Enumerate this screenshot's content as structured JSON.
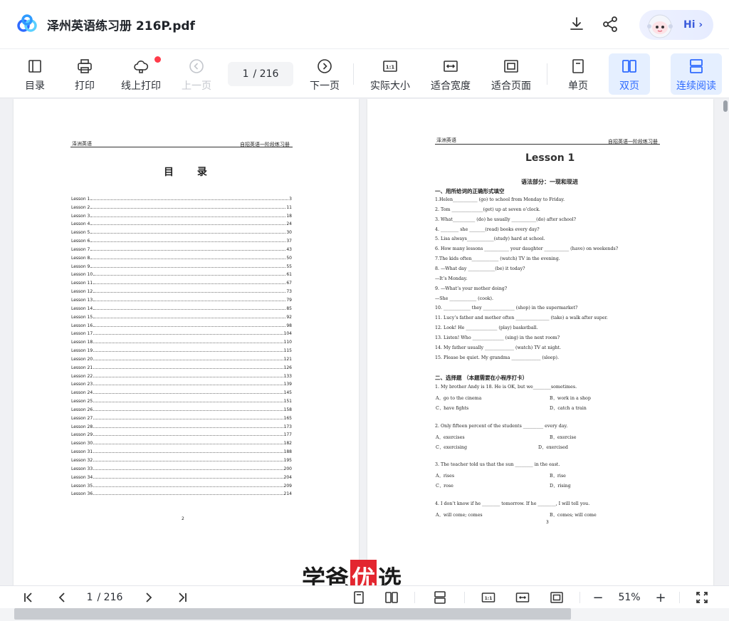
{
  "titlebar": {
    "title": "泽州英语练习册 216P.pdf",
    "hi_label": "Hi",
    "hi_chevron": "›"
  },
  "toolbar": {
    "catalog": "目录",
    "print": "打印",
    "online_print": "线上打印",
    "prev_page": "上一页",
    "page_current": "1",
    "page_total": "/ 216",
    "next_page": "下一页",
    "actual_size": "实际大小",
    "fit_width": "适合宽度",
    "fit_page": "适合页面",
    "single_page": "单页",
    "double_page": "双页",
    "continuous": "连续阅读",
    "ratio_icon_text": "1:1",
    "accent": "#2f6bff"
  },
  "left_page": {
    "header_left": "泽洲英语",
    "header_right": "自招英语一阶段练习册",
    "title": "目 录",
    "toc": [
      {
        "name": "Lesson 1",
        "page": "3"
      },
      {
        "name": "Lesson 2",
        "page": "11"
      },
      {
        "name": "Lesson 3",
        "page": "18"
      },
      {
        "name": "Lesson 4",
        "page": "24"
      },
      {
        "name": "Lesson 5",
        "page": "30"
      },
      {
        "name": "Lesson 6",
        "page": "37"
      },
      {
        "name": "Lesson 7",
        "page": "43"
      },
      {
        "name": "Lesson 8",
        "page": "50"
      },
      {
        "name": "Lesson 9",
        "page": "55"
      },
      {
        "name": "Lesson 10",
        "page": "61"
      },
      {
        "name": "Lesson 11",
        "page": "67"
      },
      {
        "name": "Lesson 12",
        "page": "73"
      },
      {
        "name": "Lesson 13",
        "page": "79"
      },
      {
        "name": "Lesson 14",
        "page": "85"
      },
      {
        "name": "Lesson 15",
        "page": "92"
      },
      {
        "name": "Lesson 16",
        "page": "98"
      },
      {
        "name": "Lesson 17",
        "page": "104"
      },
      {
        "name": "Lesson 18",
        "page": "110"
      },
      {
        "name": "Lesson 19",
        "page": "115"
      },
      {
        "name": "Lesson 20",
        "page": "121"
      },
      {
        "name": "Lesson 21",
        "page": "126"
      },
      {
        "name": "Lesson 22",
        "page": "133"
      },
      {
        "name": "Lesson 23",
        "page": "139"
      },
      {
        "name": "Lesson 24",
        "page": "145"
      },
      {
        "name": "Lesson 25",
        "page": "151"
      },
      {
        "name": "Lesson 26",
        "page": "158"
      },
      {
        "name": "Lesson 27",
        "page": "165"
      },
      {
        "name": "Lesson 28",
        "page": "173"
      },
      {
        "name": "Lesson 29",
        "page": "177"
      },
      {
        "name": "Lesson 30",
        "page": "182"
      },
      {
        "name": "Lesson 31",
        "page": "188"
      },
      {
        "name": "Lesson 32",
        "page": "195"
      },
      {
        "name": "Lesson 33",
        "page": "200"
      },
      {
        "name": "Lesson 34",
        "page": "204"
      },
      {
        "name": "Lesson 35",
        "page": "209"
      },
      {
        "name": "Lesson 36",
        "page": "214"
      }
    ],
    "page_number": "2"
  },
  "right_page": {
    "header_left": "泽洲英语",
    "header_right": "自招英语一阶段练习册",
    "lesson_title": "Lesson 1",
    "grammar_title": "语法部分：一现和现进",
    "section1": "一、用所给词的正确形式填空",
    "fill_questions": [
      "1.Helen___________ (go) to school from Monday to Friday.",
      "2. Tom ______________(get) up at seven o’clock.",
      "3. What__________ (do) he usually ___________(do) after school?",
      "4. ________ she _______(read) books every day?",
      "5. Lisa always____________(study) hard at school.",
      "6. How many lessons ___________ your daughter ___________ (have) on weekends?",
      "7.The kids often____________ (watch) TV in the evening.",
      "8.  —What day ____________(be) it today?",
      "   —It’s Monday.",
      "9. —What’s your mother doing?",
      "   —She ____________ (cook).",
      "10. ____________ they ______________ (shop) in the supermarket?",
      "11. Lucy’s father and mother often _______________ (take) a walk after super.",
      "12. Look! He ______________ (play) basketball.",
      "13. Listen! Who ______________ (sing) in the next room?",
      "14. My father usually _____________ (watch) TV at night.",
      "15. Please be quiet. My grandma _____________ (sleep)."
    ],
    "section2": "二、选择题 （本题需要在小程序打卡）",
    "mc_questions": [
      {
        "stem": "1.  My brother Andy is 18. He is OK, but we________sometimes.",
        "A": "A．go to the cinema",
        "B": "B．work in a shop",
        "C": "C．have fights",
        "D": "D．catch a train"
      },
      {
        "stem": "2.  Only fifteen percent of the students _________ every day.",
        "A": "A．exercises",
        "B": "B．exercise",
        "C": "C．exercising",
        "D": "D．exercised"
      },
      {
        "stem": "3.  The teacher told us that the sun ________ in the east.",
        "A": "A．rises",
        "B": "B．rise",
        "C": "C．rose",
        "D": "D．rising"
      },
      {
        "stem": "4.  I don’t know if he ________ tomorrow. If he ________, I will tell you.",
        "A": "A．will come; comes",
        "B": "B．comes; will come",
        "C": "",
        "D": ""
      }
    ],
    "page_number": "3"
  },
  "watermark": {
    "pre": "学爸",
    "highlight": "优",
    "post": "选"
  },
  "bottombar": {
    "page_current": "1",
    "page_total": "/ 216",
    "zoom": "51%",
    "minus": "−",
    "plus": "+",
    "ratio_icon_text": "1:1"
  }
}
